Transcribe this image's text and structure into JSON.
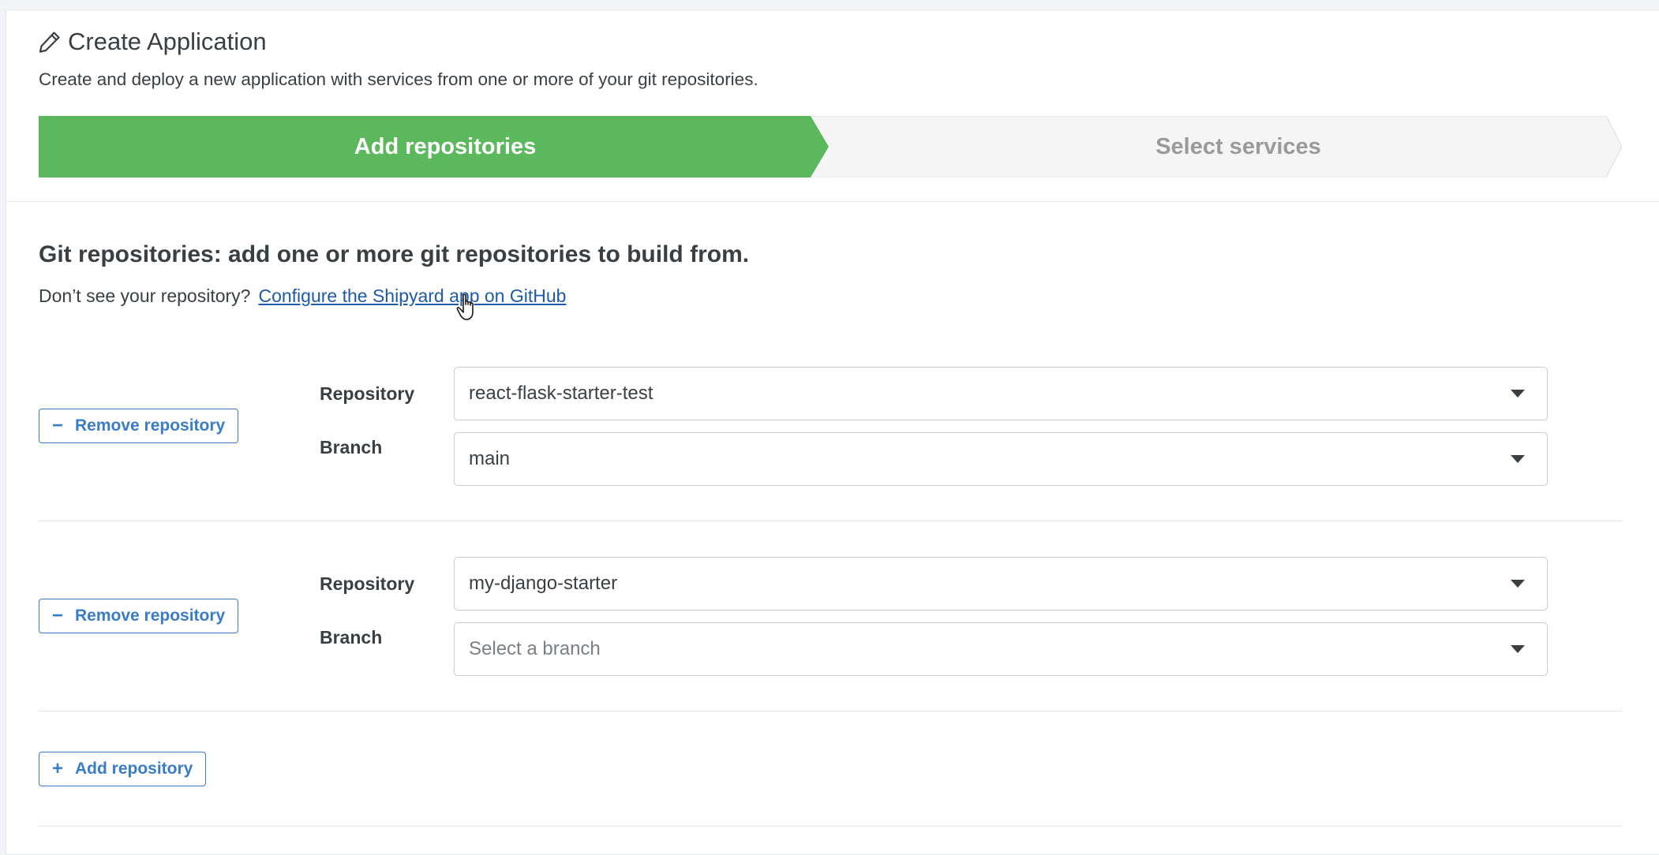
{
  "header": {
    "title": "Create Application",
    "description": "Create and deploy a new application with services from one or more of your git repositories."
  },
  "steps": [
    {
      "label": "Add repositories",
      "active": true
    },
    {
      "label": "Select services",
      "active": false
    }
  ],
  "section": {
    "title": "Git repositories: add one or more git repositories to build from.",
    "hint": "Don’t see your repository?",
    "link": "Configure the Shipyard app on GitHub"
  },
  "repositories": [
    {
      "remove_label": "Remove repository",
      "repository_label": "Repository",
      "repository_value": "react-flask-starter-test",
      "branch_label": "Branch",
      "branch_value": "main",
      "branch_placeholder": ""
    },
    {
      "remove_label": "Remove repository",
      "repository_label": "Repository",
      "repository_value": "my-django-starter",
      "branch_label": "Branch",
      "branch_value": "",
      "branch_placeholder": "Select a branch"
    }
  ],
  "add_repository_label": "Add repository",
  "colors": {
    "active_step": "#5cb85c",
    "inactive_step": "#f5f5f5",
    "accent": "#3a7cc6",
    "link": "#1e5aa8"
  },
  "icons": {
    "title": "pencil-icon",
    "remove": "minus-icon",
    "add": "plus-icon",
    "select": "caret-down-icon",
    "cursor": "hand-pointer-icon"
  }
}
